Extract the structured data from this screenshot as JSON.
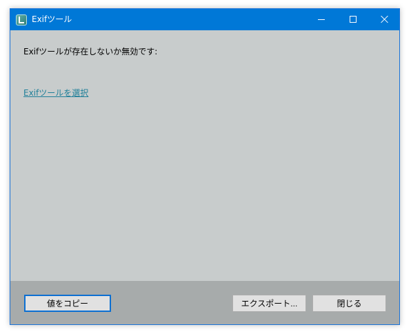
{
  "window": {
    "title": "Exifツール",
    "app_icon": "photo-app-icon",
    "controls": {
      "minimize_icon": "minimize-icon",
      "maximize_icon": "maximize-icon",
      "close_icon": "close-icon"
    }
  },
  "content": {
    "message": "Exifツールが存在しないか無効です:",
    "link_text": "Exifツールを選択"
  },
  "footer": {
    "copy_button": "値をコピー",
    "export_button": "エクスポート...",
    "close_button": "閉じる"
  },
  "colors": {
    "title_bar": "#0078d7",
    "content_background": "#c8cccc",
    "footer_background": "#a7abab",
    "link": "#1f7f99",
    "focus_border": "#0b6fd2"
  }
}
